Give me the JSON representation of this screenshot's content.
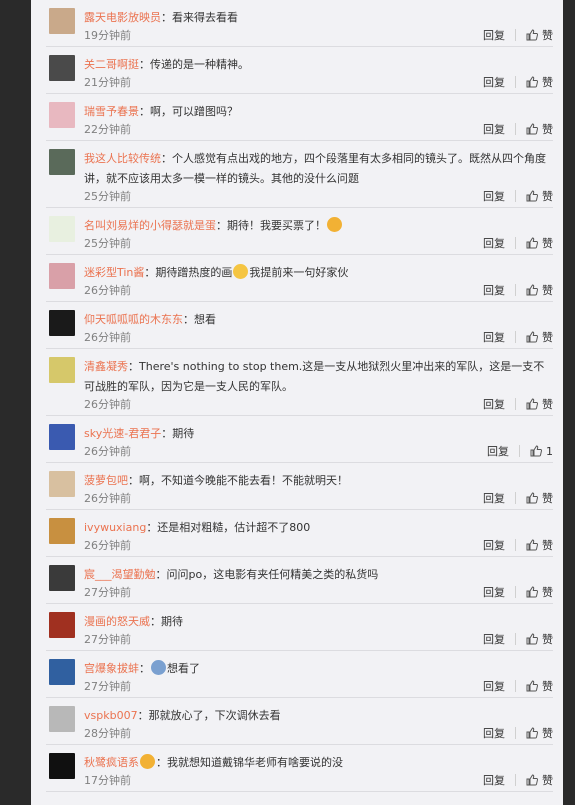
{
  "comments": [
    {
      "user": "露天电影放映员",
      "text": "：看来得去看看",
      "time": "19分钟前",
      "reply": "回复",
      "like": "赞",
      "avatar": "#c9a98a"
    },
    {
      "user": "关二哥啊挺",
      "text": "：传递的是一种精神。",
      "time": "21分钟前",
      "reply": "回复",
      "like": "赞",
      "avatar": "#4a4a4a"
    },
    {
      "user": "瑞雪予春景",
      "text": "：啊，可以蹭图吗？",
      "time": "22分钟前",
      "reply": "回复",
      "like": "赞",
      "avatar": "#e8b8c0"
    },
    {
      "user": "我这人比较传统",
      "text": "：个人感觉有点出戏的地方，四个段落里有太多相同的镜头了。既然从四个角度讲，就不应该用太多一模一样的镜头。其他的没什么问题",
      "time": "25分钟前",
      "reply": "回复",
      "like": "赞",
      "avatar": "#5a6a5a"
    },
    {
      "user": "名叫刘易烊的小得瑟就是蛋",
      "text": "：期待！我要买票了！",
      "time": "25分钟前",
      "reply": "回复",
      "like": "赞",
      "avatar": "#e8f0e0",
      "emoji": "#f2b134"
    },
    {
      "user": "迷彩型Tin酱",
      "text": "：期待蹭热度的画",
      "text2": "我提前来一句好家伙",
      "time": "26分钟前",
      "reply": "回复",
      "like": "赞",
      "avatar": "#d9a0a8",
      "emoji": "#f5c542"
    },
    {
      "user": "仰天呱呱呱的木东东",
      "text": "：想看",
      "time": "26分钟前",
      "reply": "回复",
      "like": "赞",
      "avatar": "#1a1a1a"
    },
    {
      "user": "清鑫凝秀",
      "text": "：There's nothing to stop them.这是一支从地狱烈火里冲出来的军队，这是一支不可战胜的军队，因为它是一支人民的军队。",
      "time": "26分钟前",
      "reply": "回复",
      "like": "赞",
      "avatar": "#d6c86a"
    },
    {
      "user": "sky光速-君君子",
      "text": "：期待",
      "time": "26分钟前",
      "reply": "回复",
      "like": "1",
      "avatar": "#3a5ab0"
    },
    {
      "user": "菠萝包吧",
      "text": "：啊，不知道今晚能不能去看！不能就明天！",
      "time": "26分钟前",
      "reply": "回复",
      "like": "赞",
      "avatar": "#d8c0a0"
    },
    {
      "user": "ivywuxiang",
      "text": "：还是相对粗糙，估计超不了800",
      "time": "26分钟前",
      "reply": "回复",
      "like": "赞",
      "avatar": "#c89040"
    },
    {
      "user": "宸___渴望勤勉",
      "text": "：问问po，这电影有夹任何精美之类的私货吗",
      "time": "27分钟前",
      "reply": "回复",
      "like": "赞",
      "avatar": "#3a3a3a"
    },
    {
      "user": "漫画的怒天威",
      "text": "：期待",
      "time": "27分钟前",
      "reply": "回复",
      "like": "赞",
      "avatar": "#a03020"
    },
    {
      "user": "宫爆象拔蚌",
      "text": "：",
      "text2": "想看了",
      "time": "27分钟前",
      "reply": "回复",
      "like": "赞",
      "avatar": "#3060a0",
      "emoji": "#7aa0d0"
    },
    {
      "user": "vspkb007",
      "text": "：那就放心了，下次调休去看",
      "time": "28分钟前",
      "reply": "回复",
      "like": "赞",
      "avatar": "#b8b8b8"
    },
    {
      "user": "秋鹭疯语系",
      "text": "：我就想知道戴锦华老师有啥要说的没",
      "time": "17分钟前",
      "reply": "回复",
      "like": "赞",
      "avatar": "#101010",
      "emoji": "#f2b134",
      "emojiAfterName": true
    }
  ]
}
